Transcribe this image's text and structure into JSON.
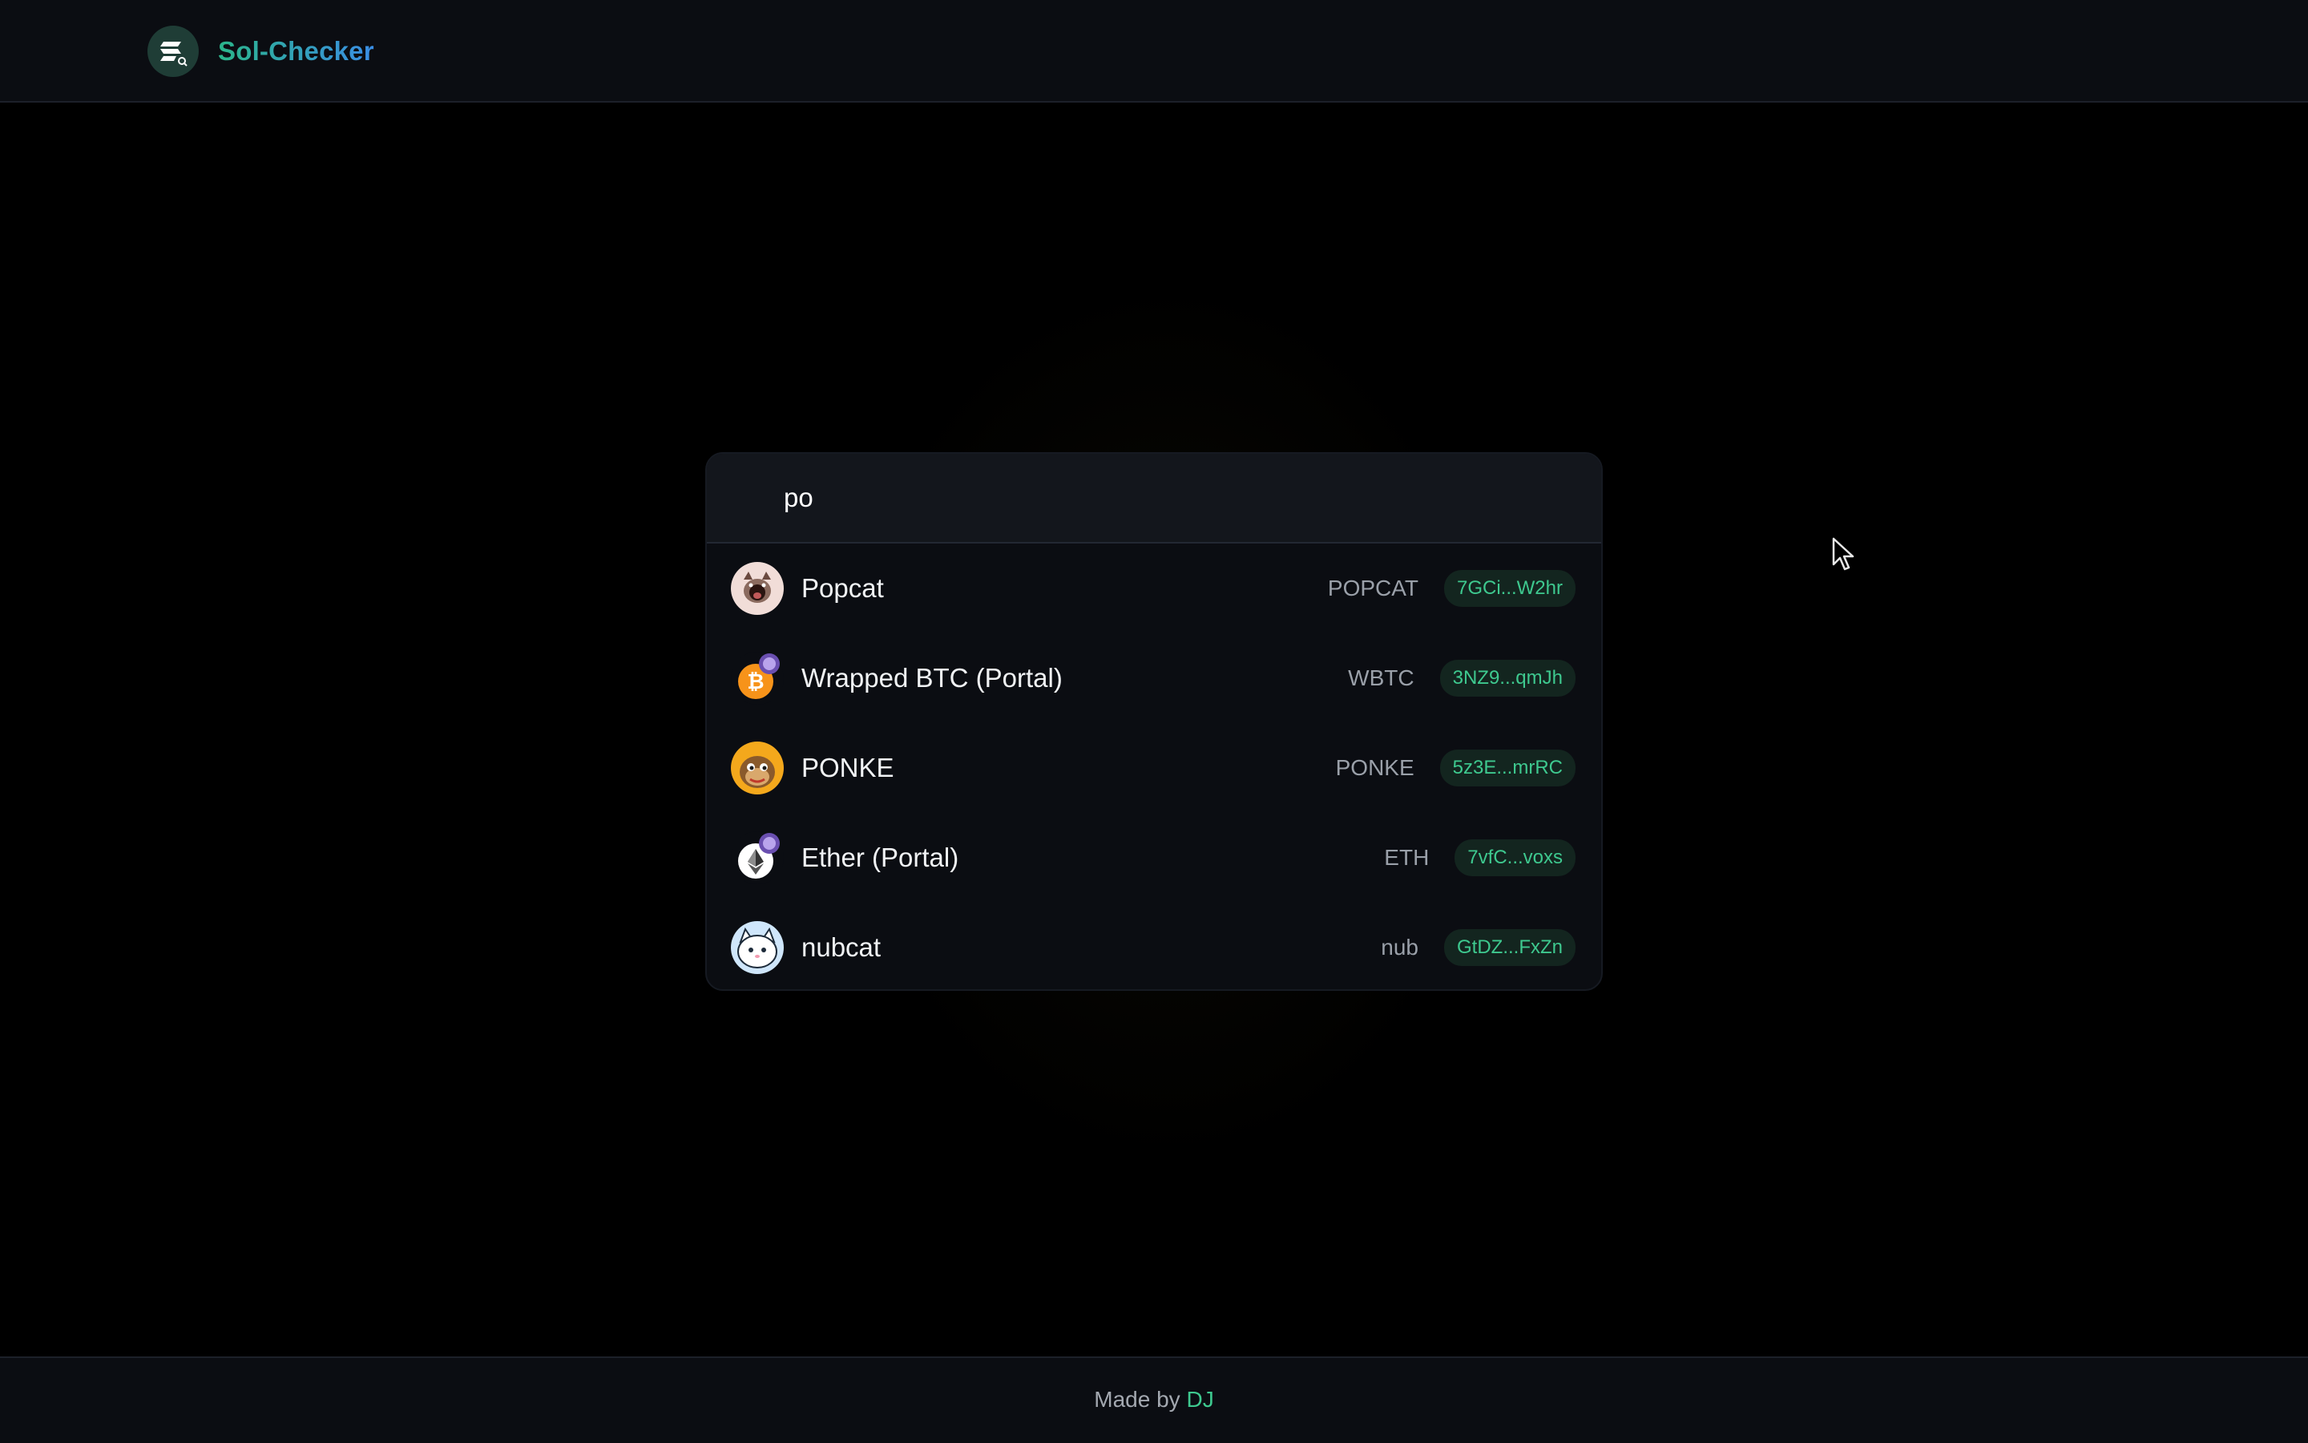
{
  "header": {
    "brand_name": "Sol-Checker",
    "logo_icon": "sol-checker-logo-icon"
  },
  "search": {
    "value": "po",
    "placeholder": ""
  },
  "results": [
    {
      "name": "Popcat",
      "symbol": "POPCAT",
      "address": "7GCi...W2hr",
      "icon": "popcat-token-icon"
    },
    {
      "name": "Wrapped BTC (Portal)",
      "symbol": "WBTC",
      "address": "3NZ9...qmJh",
      "icon": "wbtc-token-icon"
    },
    {
      "name": "PONKE",
      "symbol": "PONKE",
      "address": "5z3E...mrRC",
      "icon": "ponke-token-icon"
    },
    {
      "name": "Ether (Portal)",
      "symbol": "ETH",
      "address": "7vfC...voxs",
      "icon": "eth-token-icon"
    },
    {
      "name": "nubcat",
      "symbol": "nub",
      "address": "GtDZ...FxZn",
      "icon": "nubcat-token-icon"
    }
  ],
  "footer": {
    "made_by": "Made by",
    "author": "DJ"
  },
  "colors": {
    "accent_green": "#3ec98f",
    "accent_blue": "#3a8ee6",
    "background": "#000000",
    "panel": "#0b0d12"
  }
}
